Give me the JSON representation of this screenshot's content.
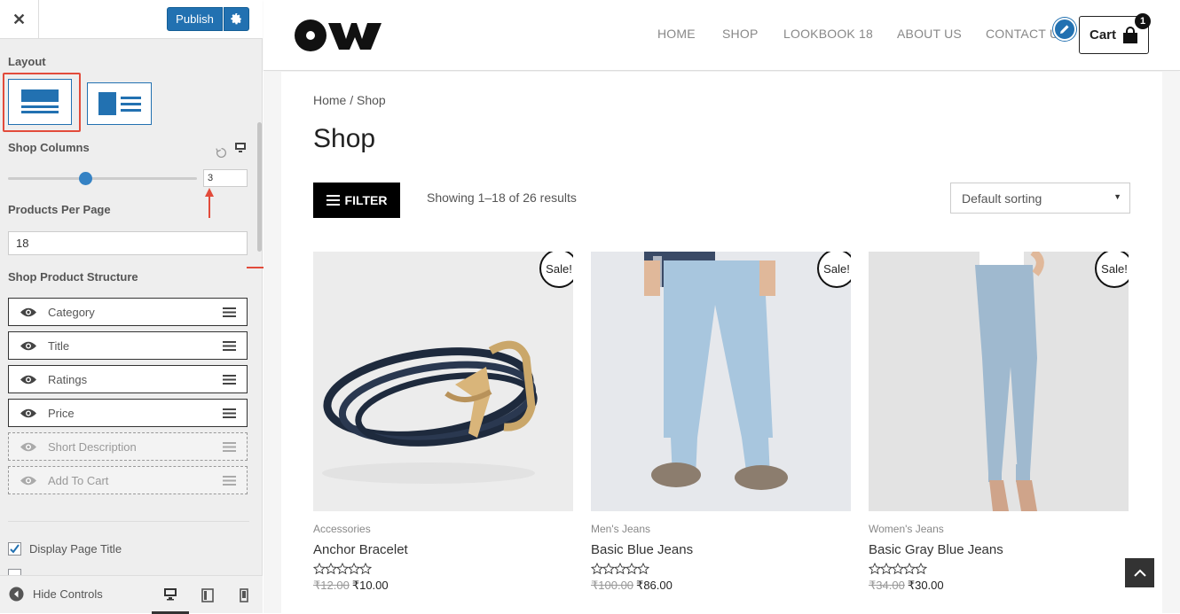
{
  "sidebar": {
    "close_icon": "close-icon",
    "publish_label": "Publish",
    "layout_label": "Layout",
    "shop_columns_label": "Shop Columns",
    "shop_columns_value": "3",
    "slider_level_fraction": 0.41,
    "products_per_page_label": "Products Per Page",
    "products_per_page_value": "18",
    "structure_label": "Shop Product Structure",
    "structure_items": [
      {
        "label": "Category",
        "enabled": true
      },
      {
        "label": "Title",
        "enabled": true
      },
      {
        "label": "Ratings",
        "enabled": true
      },
      {
        "label": "Price",
        "enabled": true
      },
      {
        "label": "Short Description",
        "enabled": false
      },
      {
        "label": "Add To Cart",
        "enabled": false
      }
    ],
    "display_page_title_label": "Display Page Title",
    "display_page_title_checked": true,
    "hide_controls_label": "Hide Controls",
    "accent_color": "#2271b1",
    "highlight_color": "#e24b3b"
  },
  "header": {
    "nav": [
      "HOME",
      "SHOP",
      "LOOKBOOK 18",
      "ABOUT US",
      "CONTACT US"
    ],
    "cart_label": "Cart",
    "cart_count": "1"
  },
  "shop": {
    "breadcrumb": "Home / Shop",
    "title": "Shop",
    "filter_label": "FILTER",
    "results_text": "Showing 1–18 of 26 results",
    "sort_value": "Default sorting",
    "products": [
      {
        "category": "Accessories",
        "title": "Anchor Bracelet",
        "old_price": "₹12.00",
        "price": "₹10.00",
        "badge": "Sale!"
      },
      {
        "category": "Men's Jeans",
        "title": "Basic Blue Jeans",
        "old_price": "₹100.00",
        "price": "₹86.00",
        "badge": "Sale!"
      },
      {
        "category": "Women's Jeans",
        "title": "Basic Gray Blue Jeans",
        "old_price": "₹34.00",
        "price": "₹30.00",
        "badge": "Sale!"
      }
    ]
  }
}
